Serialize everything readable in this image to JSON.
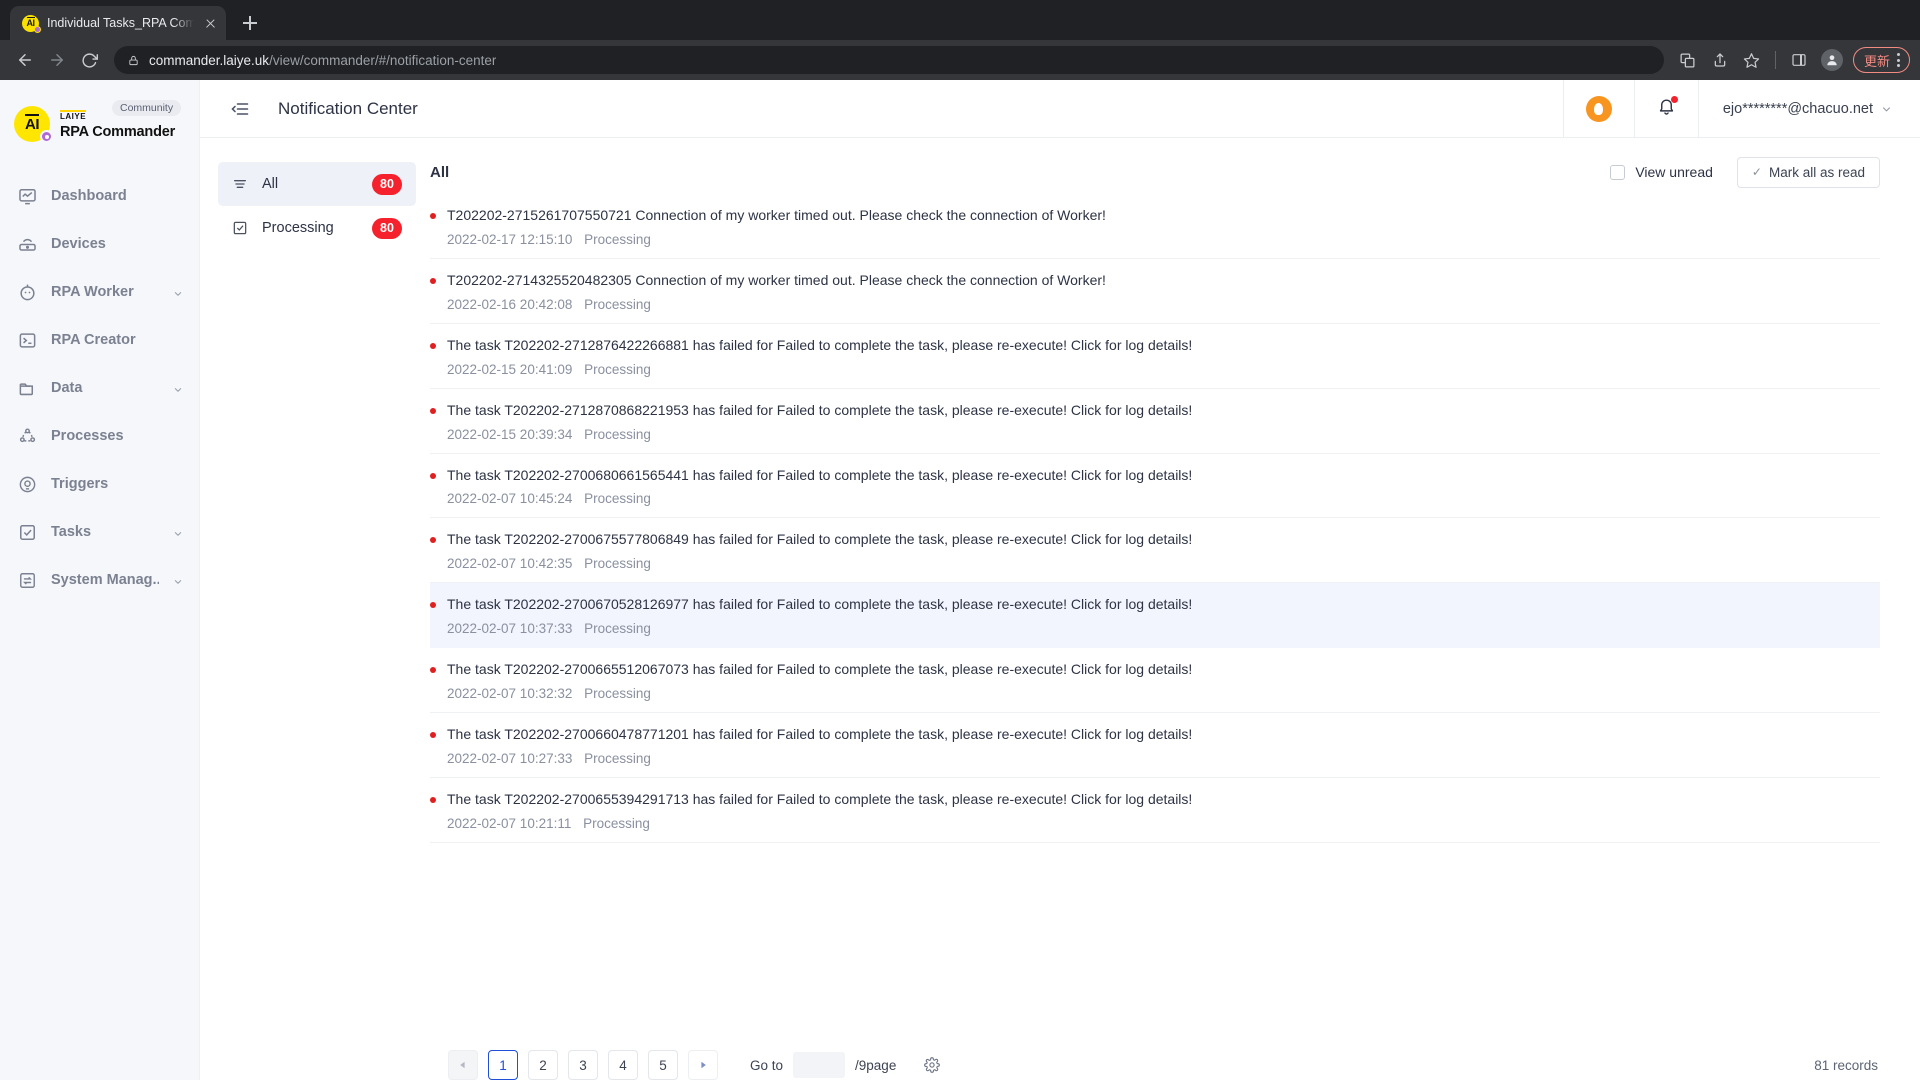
{
  "browser": {
    "tab": {
      "title": "Individual Tasks_RPA Commander",
      "favicon": "laiye-ai-icon"
    },
    "new_tab_label": "+",
    "url": {
      "host": "commander.laiye.uk",
      "path": "/view/commander/#/notification-center"
    },
    "toolbar_icons": [
      "back-arrow",
      "forward-arrow",
      "reload",
      "lock",
      "translate",
      "share",
      "bookmark-star",
      "side-panel",
      "profile-avatar",
      "kebab-menu"
    ],
    "update_label": "更新"
  },
  "sidebar": {
    "brand": {
      "sub": "LAIYE",
      "name": "RPA Commander",
      "chip": "Community"
    },
    "items": [
      {
        "label": "Dashboard",
        "icon": "dashboard-icon",
        "expandable": false
      },
      {
        "label": "Devices",
        "icon": "device-icon",
        "expandable": false
      },
      {
        "label": "RPA Worker",
        "icon": "robot-icon",
        "expandable": true
      },
      {
        "label": "RPA Creator",
        "icon": "terminal-icon",
        "expandable": false
      },
      {
        "label": "Data",
        "icon": "folder-icon",
        "expandable": true
      },
      {
        "label": "Processes",
        "icon": "process-icon",
        "expandable": false
      },
      {
        "label": "Triggers",
        "icon": "trigger-icon",
        "expandable": false
      },
      {
        "label": "Tasks",
        "icon": "checkbox-icon",
        "expandable": true
      },
      {
        "label": "System Manag...",
        "icon": "system-icon",
        "expandable": true
      }
    ]
  },
  "topbar": {
    "collapse_icon": "collapse-sidebar-icon",
    "title": "Notification Center",
    "help_icon": "lightbulb-icon",
    "bell_icon": "bell-icon",
    "user": "ejo********@chacuo.net"
  },
  "filters": [
    {
      "label": "All",
      "count": "80",
      "icon": "list-icon",
      "active": true
    },
    {
      "label": "Processing",
      "count": "80",
      "icon": "task-icon",
      "active": false
    }
  ],
  "panel": {
    "title": "All",
    "view_unread_label": "View unread",
    "view_unread_checked": false,
    "mark_all_label": "Mark all as read",
    "mark_all_tick": "✓"
  },
  "notifications": [
    {
      "text": "T202202-2715261707550721 Connection of my worker timed out. Please check the connection of Worker!",
      "time": "2022-02-17 12:15:10",
      "status": "Processing",
      "unread": true,
      "hovered": false
    },
    {
      "text": "T202202-2714325520482305 Connection of my worker timed out. Please check the connection of Worker!",
      "time": "2022-02-16 20:42:08",
      "status": "Processing",
      "unread": true,
      "hovered": false
    },
    {
      "text": "The task T202202-2712876422266881 has failed for Failed to complete the task, please re-execute! Click for log details!",
      "time": "2022-02-15 20:41:09",
      "status": "Processing",
      "unread": true,
      "hovered": false
    },
    {
      "text": "The task T202202-2712870868221953 has failed for Failed to complete the task, please re-execute! Click for log details!",
      "time": "2022-02-15 20:39:34",
      "status": "Processing",
      "unread": true,
      "hovered": false
    },
    {
      "text": "The task T202202-2700680661565441 has failed for Failed to complete the task, please re-execute! Click for log details!",
      "time": "2022-02-07 10:45:24",
      "status": "Processing",
      "unread": true,
      "hovered": false
    },
    {
      "text": "The task T202202-2700675577806849 has failed for Failed to complete the task, please re-execute! Click for log details!",
      "time": "2022-02-07 10:42:35",
      "status": "Processing",
      "unread": true,
      "hovered": false
    },
    {
      "text": "The task T202202-2700670528126977 has failed for Failed to complete the task, please re-execute! Click for log details!",
      "time": "2022-02-07 10:37:33",
      "status": "Processing",
      "unread": true,
      "hovered": true
    },
    {
      "text": "The task T202202-2700665512067073 has failed for Failed to complete the task, please re-execute! Click for log details!",
      "time": "2022-02-07 10:32:32",
      "status": "Processing",
      "unread": true,
      "hovered": false
    },
    {
      "text": "The task T202202-2700660478771201 has failed for Failed to complete the task, please re-execute! Click for log details!",
      "time": "2022-02-07 10:27:33",
      "status": "Processing",
      "unread": true,
      "hovered": false
    },
    {
      "text": "The task T202202-2700655394291713 has failed for Failed to complete the task, please re-execute! Click for log details!",
      "time": "2022-02-07 10:21:11",
      "status": "Processing",
      "unread": true,
      "hovered": false
    }
  ],
  "pagination": {
    "prev": "◀",
    "next": "▶",
    "pages": [
      "1",
      "2",
      "3",
      "4",
      "5"
    ],
    "current": "1",
    "goto_label": "Go to",
    "goto_value": "",
    "per_page_label": "/9page",
    "settings_icon": "gear-icon",
    "records": "81 records"
  },
  "colors": {
    "accent": "#1f4ed8",
    "danger": "#f5222d",
    "brand_yellow": "#ffe600",
    "hover_row": "#f2f5fd"
  }
}
